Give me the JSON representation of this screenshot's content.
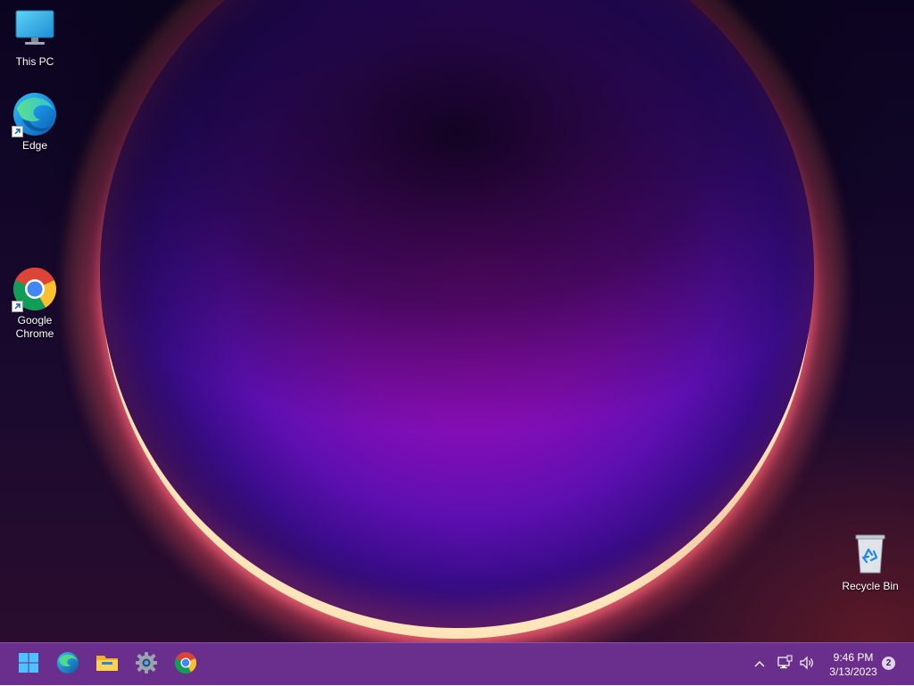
{
  "desktop": {
    "icons": [
      {
        "label": "This PC",
        "icon": "monitor-icon"
      },
      {
        "label": "Edge",
        "icon": "edge-icon",
        "shortcut": true
      },
      {
        "label": "Google Chrome",
        "icon": "chrome-icon",
        "shortcut": true
      },
      {
        "label": "Recycle Bin",
        "icon": "recycle-bin-icon"
      }
    ]
  },
  "taskbar": {
    "apps": [
      {
        "name": "Start",
        "icon": "windows-start-icon"
      },
      {
        "name": "Microsoft Edge",
        "icon": "edge-icon"
      },
      {
        "name": "File Explorer",
        "icon": "folder-icon"
      },
      {
        "name": "Settings",
        "icon": "gear-icon"
      },
      {
        "name": "Google Chrome",
        "icon": "chrome-icon"
      }
    ],
    "tray": {
      "icons": [
        "chevron-up-icon",
        "network-icon",
        "volume-icon"
      ],
      "time": "9:46 PM",
      "date": "3/13/2023",
      "notification_count": "2"
    }
  },
  "colors": {
    "taskbar_bg": "#6a2f8c",
    "accent": "#a90fc0"
  }
}
